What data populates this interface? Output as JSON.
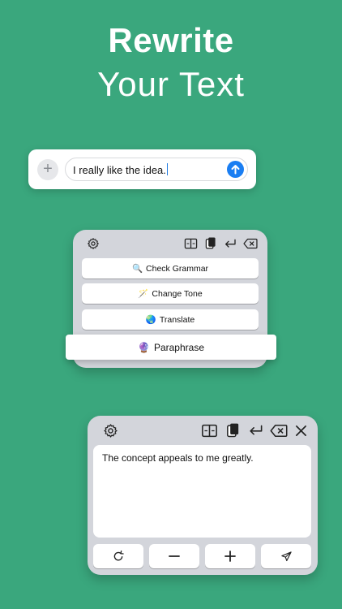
{
  "headline": {
    "line1": "Rewrite",
    "line2": "Your Text"
  },
  "message_bar": {
    "input_value": "I really like the idea.",
    "add_label": "+"
  },
  "mini_keyboard": {
    "icons": [
      "settings-icon",
      "split-view-icon",
      "copy-icon",
      "return-icon",
      "delete-icon"
    ],
    "actions": [
      {
        "emoji": "🔍",
        "label": "Check Grammar"
      },
      {
        "emoji": "🪄",
        "label": "Change Tone"
      },
      {
        "emoji": "🌏",
        "label": "Translate"
      },
      {
        "emoji": "🔮",
        "label": "Paraphrase"
      }
    ]
  },
  "expanded_keyboard": {
    "icons": [
      "settings-icon",
      "split-view-icon",
      "copy-icon",
      "return-icon",
      "delete-icon",
      "close-icon"
    ],
    "output_text": "The concept appeals to me greatly.",
    "bottom_keys": [
      "refresh-icon",
      "minus-icon",
      "plus-icon",
      "send-icon"
    ]
  },
  "colors": {
    "background": "#3aa77d",
    "panel": "#d3d5db",
    "accent_blue": "#1a7ef2"
  }
}
